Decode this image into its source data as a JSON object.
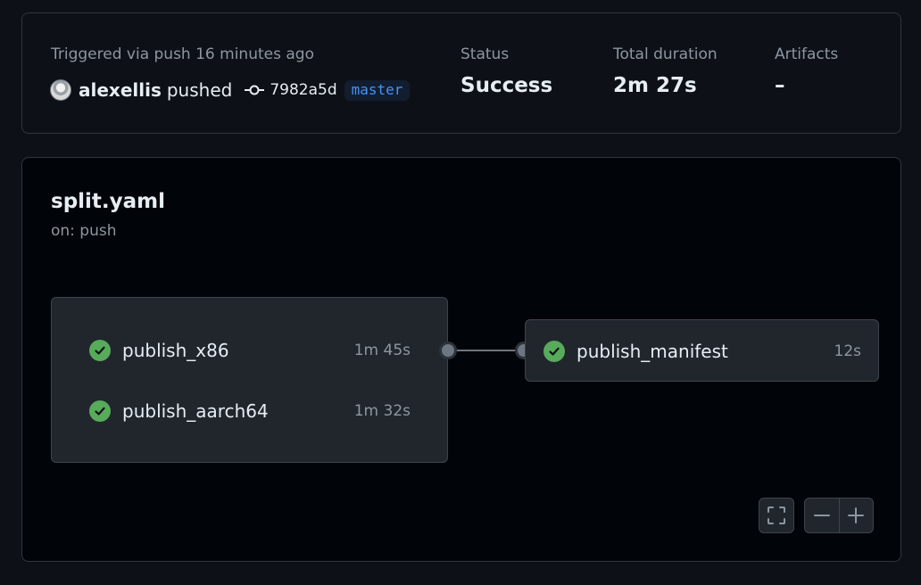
{
  "summary": {
    "trigger_label": "Triggered via push 16 minutes ago",
    "actor": "alexellis",
    "action": "pushed",
    "commit_sha": "7982a5d",
    "branch": "master",
    "status_label": "Status",
    "status_value": "Success",
    "duration_label": "Total duration",
    "duration_value": "2m 27s",
    "artifacts_label": "Artifacts",
    "artifacts_value": "–"
  },
  "workflow": {
    "name": "split.yaml",
    "trigger": "on: push",
    "job_group": [
      {
        "name": "publish_x86",
        "duration": "1m 45s",
        "status": "success"
      },
      {
        "name": "publish_aarch64",
        "duration": "1m 32s",
        "status": "success"
      }
    ],
    "dependent_job": {
      "name": "publish_manifest",
      "duration": "12s",
      "status": "success"
    }
  },
  "icons": {
    "avatar": "user-avatar",
    "commit": "git-commit-icon",
    "success": "check-circle-fill-icon",
    "fullscreen": "screen-full-icon",
    "zoom_out": "minus-icon",
    "zoom_in": "plus-icon"
  },
  "colors": {
    "success": "#57ab5a",
    "branch_text": "#4493f8",
    "branch_bg": "#121d2f",
    "muted_text": "#8d96a0"
  }
}
